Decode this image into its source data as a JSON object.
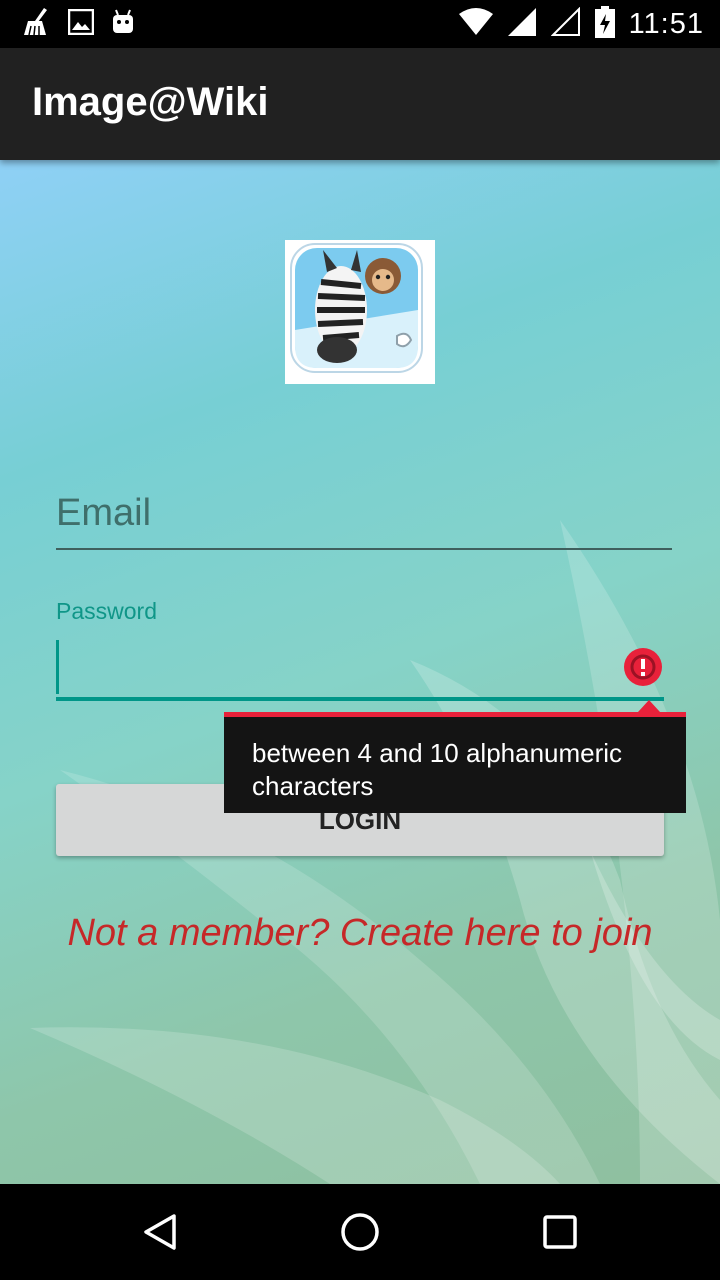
{
  "status_bar": {
    "time": "11:51",
    "left_icons": [
      "cleaner-icon",
      "image-icon",
      "android-icon"
    ],
    "right_icons": [
      "wifi-icon",
      "signal-icon",
      "signal-empty-icon",
      "battery-charging-icon"
    ]
  },
  "app_bar": {
    "title": "Image@Wiki"
  },
  "login": {
    "email_placeholder": "Email",
    "password_label": "Password",
    "password_value": "",
    "error_message": "between 4 and 10 alphanumeric characters",
    "login_button": "LOGIN",
    "signup_link": "Not a member? Create here to join"
  },
  "colors": {
    "app_bar": "#212121",
    "accent": "#009688",
    "error": "#e8213a",
    "link": "#c62828",
    "button": "#d6d7d7"
  },
  "nav_bar": {
    "icons": [
      "back-icon",
      "home-icon",
      "recents-icon"
    ]
  }
}
